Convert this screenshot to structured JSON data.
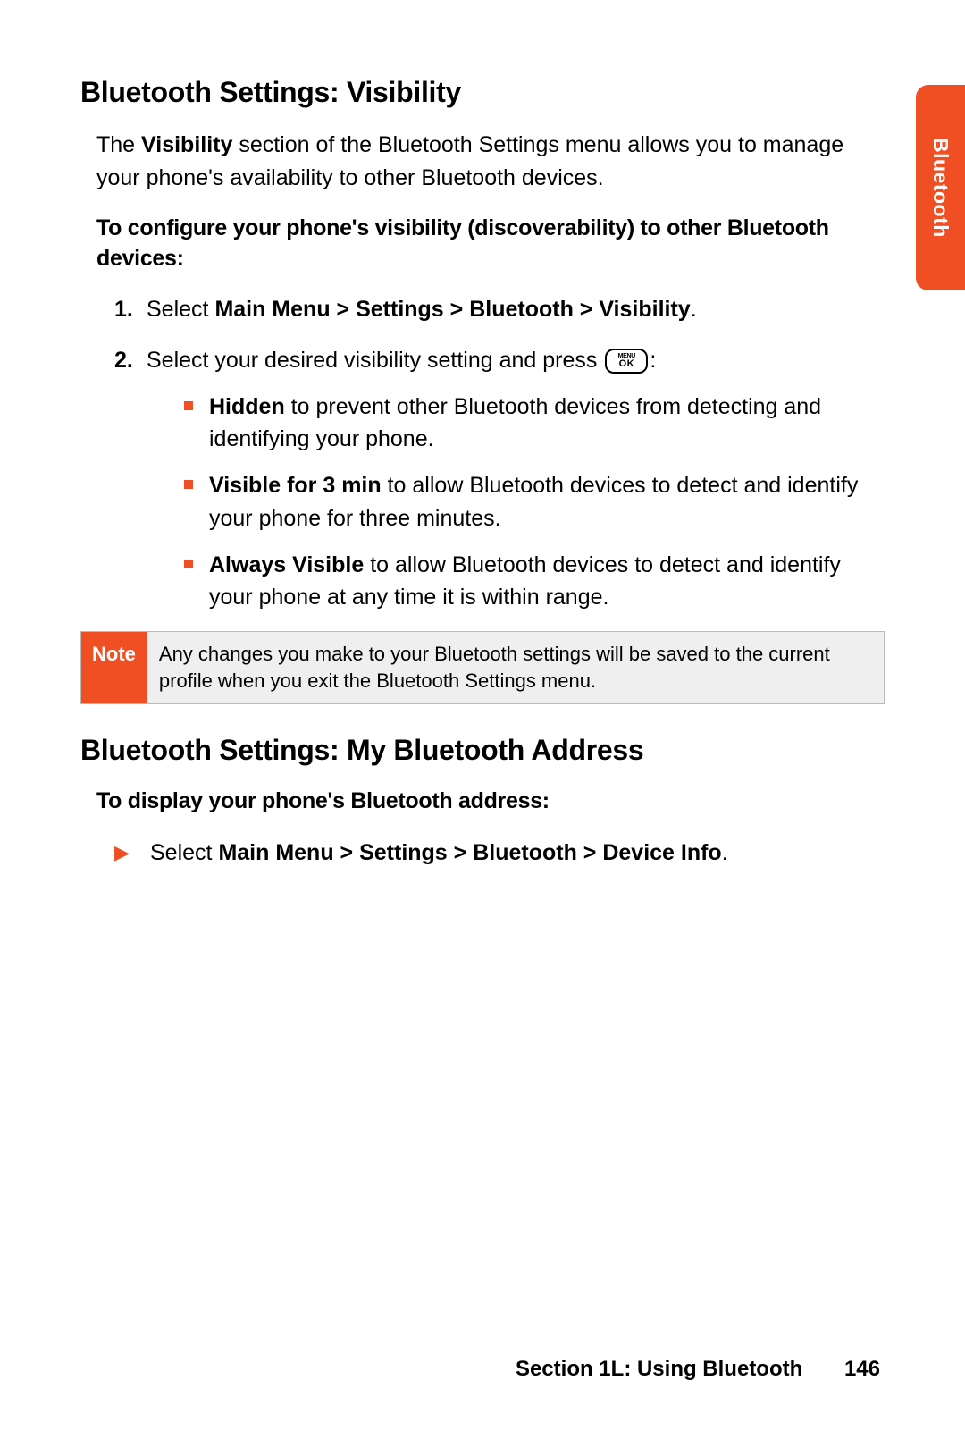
{
  "sideTab": "Bluetooth",
  "section1": {
    "heading": "Bluetooth Settings: Visibility",
    "introLead": "Visibility",
    "introPrefix": "The ",
    "introRest": " section of the Bluetooth Settings menu allows you to manage your phone's availability to other Bluetooth devices.",
    "subHead": "To configure your phone's visibility (discoverability) to other Bluetooth devices:",
    "step1": {
      "num": "1.",
      "prefix": "Select ",
      "path": "Main Menu > Settings > Bluetooth > Visibility",
      "suffix": "."
    },
    "step2": {
      "num": "2.",
      "textBefore": "Select your desired visibility setting and press ",
      "keyTop": "MENU",
      "keyBottom": "OK",
      "textAfter": ":"
    },
    "bullets": [
      {
        "bold": "Hidden",
        "rest": " to prevent other Bluetooth devices from detecting and identifying your phone."
      },
      {
        "bold": "Visible for 3 min",
        "rest": " to allow Bluetooth devices to detect and identify your phone for three minutes."
      },
      {
        "bold": "Always Visible",
        "rest": " to allow Bluetooth devices to detect and identify your phone at any time it is within range."
      }
    ]
  },
  "note": {
    "label": "Note",
    "body": "Any changes you make to your Bluetooth settings will be saved to the current profile when you exit the Bluetooth Settings menu."
  },
  "section2": {
    "heading": "Bluetooth Settings: My Bluetooth Address",
    "subHead": "To display your phone's Bluetooth address:",
    "item": {
      "prefix": "Select ",
      "path": "Main Menu > Settings > Bluetooth > Device Info",
      "suffix": "."
    }
  },
  "footer": {
    "sectionLabel": "Section 1L: Using Bluetooth",
    "pageNumber": "146"
  }
}
